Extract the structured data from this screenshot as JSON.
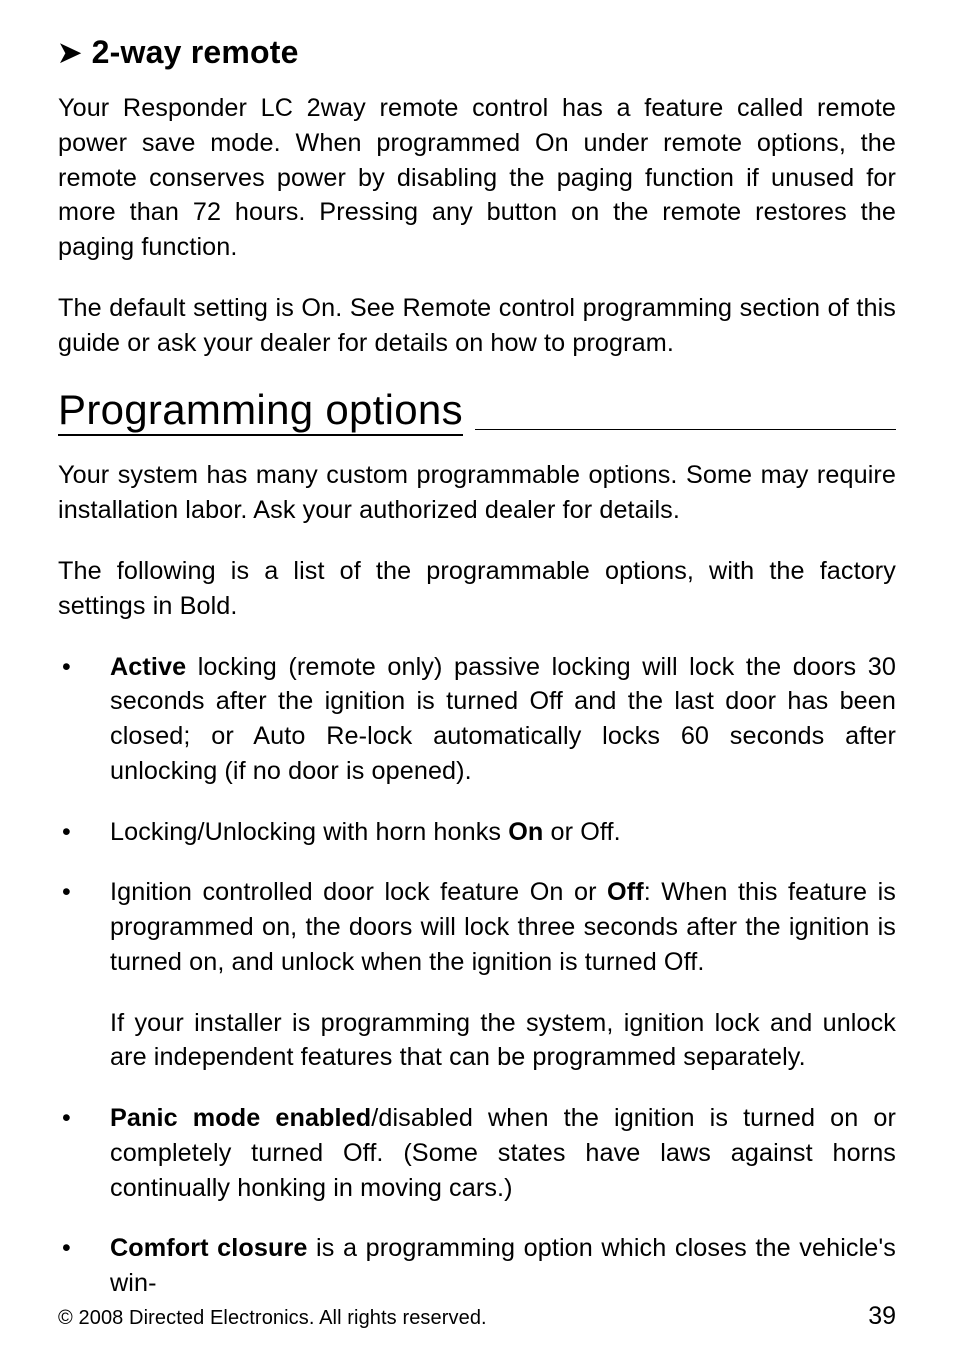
{
  "section1": {
    "heading": "2-way remote",
    "para1": "Your Responder LC 2way remote control has a feature called remote power save mode. When programmed On under remote options, the remote conserves power by disabling the paging function if unused for more than 72 hours. Pressing any button on the remote restores the paging function.",
    "para2": "The default setting is On. See Remote control programming section of this guide or ask your dealer for details on how to program."
  },
  "section2": {
    "heading": "Programming options",
    "para1": "Your system has many custom programmable options. Some may require installation labor. Ask your authorized dealer for details.",
    "para2": "The following is a list of the programmable options, with the factory settings in Bold.",
    "bullets": {
      "b1_bold": "Active",
      "b1_rest": " locking (remote only) passive locking will lock the doors 30 seconds after the ignition is turned Off and the last door has been closed; or Auto Re-lock automatically locks 60 seconds after unlocking (if no door is opened).",
      "b2_pre": "Locking/Unlocking with horn honks ",
      "b2_bold": "On",
      "b2_post": " or Off.",
      "b3_pre": "Ignition controlled door lock feature On or ",
      "b3_bold": "Off",
      "b3_post": ": When this feature is programmed on, the doors will lock three seconds after the ignition is turned on, and unlock when the ignition is turned Off.",
      "b3_sub": "If your installer is programming the system, ignition lock and unlock are independent features that can be programmed separately.",
      "b4_bold": "Panic mode enabled",
      "b4_rest": "/disabled when the ignition is turned on or completely turned Off. (Some states have laws against horns continually honking in moving cars.)",
      "b5_bold": "Comfort closure",
      "b5_rest": " is a programming option which closes the vehicle's win-"
    }
  },
  "footer": {
    "copyright": "© 2008 Directed Electronics. All rights reserved.",
    "page": "39"
  }
}
